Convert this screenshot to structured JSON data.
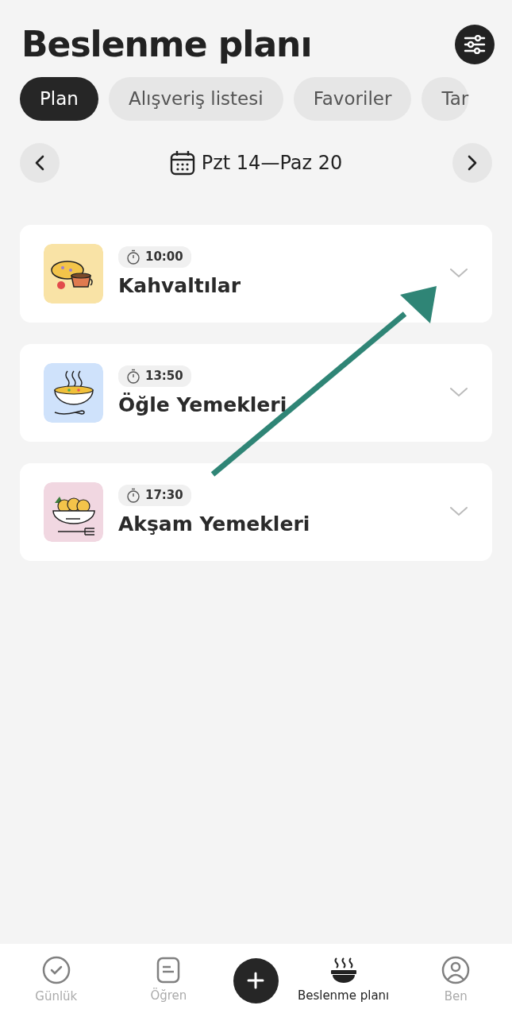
{
  "header": {
    "title": "Beslenme planı"
  },
  "tabs": [
    {
      "label": "Plan",
      "selected": true
    },
    {
      "label": "Alışveriş listesi",
      "selected": false
    },
    {
      "label": "Favoriler",
      "selected": false
    },
    {
      "label": "Tar",
      "selected": false
    }
  ],
  "week": {
    "range": "Pzt 14—Paz 20"
  },
  "meals": [
    {
      "kind": "breakfast",
      "time": "10:00",
      "name": "Kahvaltılar",
      "color": "#f9e3a6"
    },
    {
      "kind": "lunch",
      "time": "13:50",
      "name": "Öğle Yemekleri",
      "color": "#cfe2fb"
    },
    {
      "kind": "dinner",
      "time": "17:30",
      "name": "Akşam Yemekleri",
      "color": "#f1d7e1"
    }
  ],
  "bottom_nav": [
    {
      "kind": "check",
      "label": "Günlük",
      "selected": false
    },
    {
      "kind": "note",
      "label": "Öğren",
      "selected": false
    },
    {
      "kind": "add"
    },
    {
      "kind": "bowl",
      "label": "Beslenme planı",
      "selected": true
    },
    {
      "kind": "person",
      "label": "Ben",
      "selected": false
    }
  ]
}
